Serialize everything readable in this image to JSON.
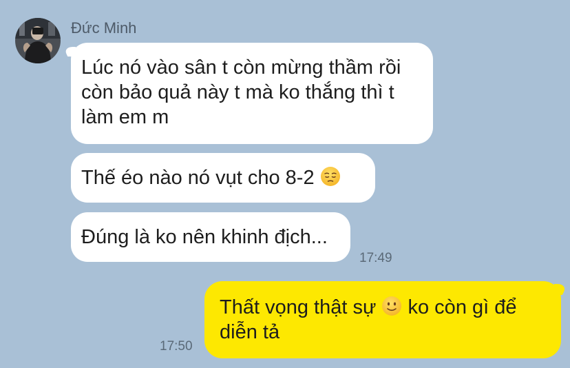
{
  "conversation": {
    "sender_name": "Đức Minh",
    "incoming": [
      {
        "lines": [
          "Lúc nó vào sân t còn mừng thầm rồi",
          "còn bảo quả này t mà ko thắng thì t",
          "làm em m"
        ]
      },
      {
        "text": "Thế éo nào nó vụt cho 8-2",
        "emoji": "pensive-face-icon"
      },
      {
        "text": "Đúng là ko nên khinh địch..."
      }
    ],
    "incoming_time": "17:49",
    "outgoing": {
      "line1_before_emoji": "Thất vọng thật sự",
      "emoji": "slightly-smiling-face-icon",
      "line1_after_emoji": "ko còn gì để",
      "line2": "diễn tả"
    },
    "outgoing_time": "17:50"
  },
  "colors": {
    "background": "#a9c0d6",
    "incoming_bubble": "#ffffff",
    "outgoing_bubble": "#fde801",
    "timestamp": "#5a6977",
    "sender_name": "#4d5a68"
  }
}
